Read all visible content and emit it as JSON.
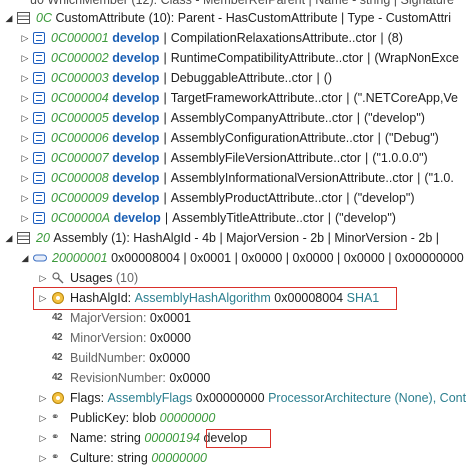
{
  "top_cut_text": "u0 WhichMember (12): Class - MemberRefParent | Name - string | Signature",
  "custom_attr": {
    "index": "0C",
    "label": "CustomAttribute",
    "summary": "(10): Parent - HasCustomAttribute | Type - CustomAttri",
    "rows": [
      {
        "id": "0C000001",
        "name": "develop",
        "ctor": "CompilationRelaxationsAttribute..ctor",
        "arg": "(8)"
      },
      {
        "id": "0C000002",
        "name": "develop",
        "ctor": "RuntimeCompatibilityAttribute..ctor",
        "arg": "(WrapNonExce"
      },
      {
        "id": "0C000003",
        "name": "develop",
        "ctor": "DebuggableAttribute..ctor",
        "arg": "()"
      },
      {
        "id": "0C000004",
        "name": "develop",
        "ctor": "TargetFrameworkAttribute..ctor",
        "arg": "(\".NETCoreApp,Ve"
      },
      {
        "id": "0C000005",
        "name": "develop",
        "ctor": "AssemblyCompanyAttribute..ctor",
        "arg": "(\"develop\")"
      },
      {
        "id": "0C000006",
        "name": "develop",
        "ctor": "AssemblyConfigurationAttribute..ctor",
        "arg": "(\"Debug\")"
      },
      {
        "id": "0C000007",
        "name": "develop",
        "ctor": "AssemblyFileVersionAttribute..ctor",
        "arg": "(\"1.0.0.0\")"
      },
      {
        "id": "0C000008",
        "name": "develop",
        "ctor": "AssemblyInformationalVersionAttribute..ctor",
        "arg": "(\"1.0."
      },
      {
        "id": "0C000009",
        "name": "develop",
        "ctor": "AssemblyProductAttribute..ctor",
        "arg": "(\"develop\")"
      },
      {
        "id": "0C00000A",
        "name": "develop",
        "ctor": "AssemblyTitleAttribute..ctor",
        "arg": "(\"develop\")"
      }
    ]
  },
  "assembly": {
    "index": "20",
    "label": "Assembly",
    "summary": "(1): HashAlgId - 4b | MajorVersion - 2b | MinorVersion - 2b |",
    "row": {
      "id": "20000001",
      "values": "0x00008004 | 0x0001 | 0x0000 | 0x0000 | 0x0000 | 0x00000000"
    },
    "usages": {
      "label": "Usages",
      "count": "(10)"
    },
    "hash": {
      "label": "HashAlgId:",
      "type": "AssemblyHashAlgorithm",
      "value": "0x00008004",
      "name": "SHA1"
    },
    "fields": [
      {
        "label": "MajorVersion:",
        "value": "0x0001"
      },
      {
        "label": "MinorVersion:",
        "value": "0x0000"
      },
      {
        "label": "BuildNumber:",
        "value": "0x0000"
      },
      {
        "label": "RevisionNumber:",
        "value": "0x0000"
      }
    ],
    "flags": {
      "label": "Flags:",
      "type": "AssemblyFlags",
      "value": "0x00000000",
      "rest": "ProcessorArchitecture (None), Cont"
    },
    "publickey": {
      "label": "PublicKey:",
      "type": "blob",
      "value": "00000000"
    },
    "name": {
      "label": "Name:",
      "type": "string",
      "value": "00000194",
      "str": "develop"
    },
    "culture": {
      "label": "Culture:",
      "type": "string",
      "value": "00000000"
    }
  }
}
